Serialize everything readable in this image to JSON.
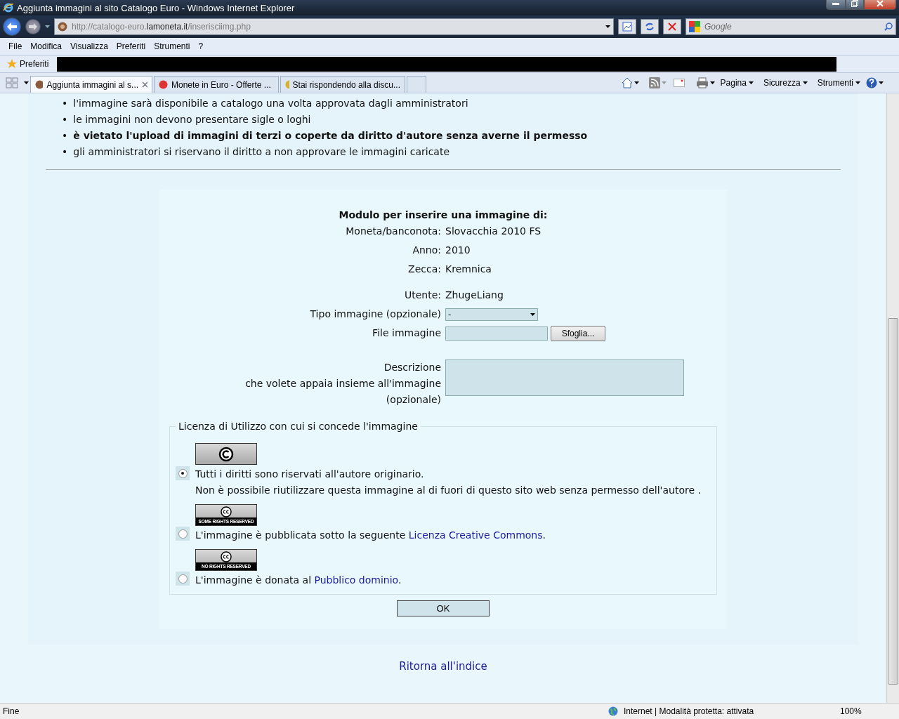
{
  "window": {
    "title": "Aggiunta immagini al sito Catalogo Euro - Windows Internet Explorer"
  },
  "address": {
    "url": "http://catalogo-euro.**lamoneta.it**/inserisciimg.php"
  },
  "search": {
    "placeholder": "Google"
  },
  "menu": [
    "File",
    "Modifica",
    "Visualizza",
    "Preferiti",
    "Strumenti",
    "?"
  ],
  "favorites": {
    "label": "Preferiti"
  },
  "tabs": [
    {
      "label": "Aggiunta immagini al s...",
      "selected": true
    },
    {
      "label": "Monete in Euro - Offerte ...",
      "selected": false
    },
    {
      "label": "Stai rispondendo alla discu...",
      "selected": false
    }
  ],
  "command_bar": [
    "Pagina",
    "Sicurezza",
    "Strumenti"
  ],
  "rules": [
    {
      "marker": "•",
      "text": "l'immagine sarà disponibile a catalogo una volta approvata dagli amministratori",
      "emphasized": false
    },
    {
      "marker": "•",
      "text": "le immagini non devono presentare sigle o loghi",
      "emphasized": false
    },
    {
      "marker": "•",
      "text": "è vietato l'upload di immagini di terzi o coperte da diritto d'autore senza averne il permesso",
      "emphasized": true
    },
    {
      "marker": "•",
      "text": "gli amministratori si riservano il diritto a non approvare le immagini caricate",
      "emphasized": false
    }
  ],
  "form": {
    "heading": "Modulo per inserire una immagine di:",
    "info": [
      {
        "label": "Moneta/banconota:",
        "value": "Slovacchia 2010 FS"
      },
      {
        "label": "Anno:",
        "value": "2010"
      },
      {
        "label": "Zecca:",
        "value": "Kremnica"
      }
    ],
    "user": {
      "label": "Utente:",
      "value": "ZhugeLiang"
    },
    "image_type": {
      "label": "Tipo immagine (opzionale)",
      "value": "-"
    },
    "file": {
      "label": "File immagine",
      "button": "Sfoglia..."
    },
    "description": {
      "label": [
        "Descrizione",
        "che volete appaia insieme all'immagine",
        "(opzionale)"
      ]
    },
    "license": {
      "legend": "Licenza di Utilizzo con cui si concede l'immagine",
      "options": [
        {
          "kind": "copyright",
          "selected": true,
          "lines": [
            "Tutti i diritti sono riservati all'autore originario.",
            "Non è possibile riutilizzare questa immagine al di fuori di questo sito web senza permesso dell'autore ."
          ]
        },
        {
          "kind": "cc",
          "badge": "SOME RIGHTS RESERVED",
          "selected": false,
          "before": "L'immagine è pubblicata sotto la seguente ",
          "link": "Licenza Creative Commons",
          "after": "."
        },
        {
          "kind": "cc",
          "badge": "NO RIGHTS RESERVED",
          "selected": false,
          "before": "L'immagine è donata al ",
          "link": "Pubblico dominio",
          "after": "."
        }
      ]
    },
    "submit": "OK"
  },
  "back_link": "Ritorna all'indice",
  "status_bar": {
    "text": "Fine",
    "zone": "Internet | Modalità protetta: attivata",
    "zoom": "100%"
  }
}
